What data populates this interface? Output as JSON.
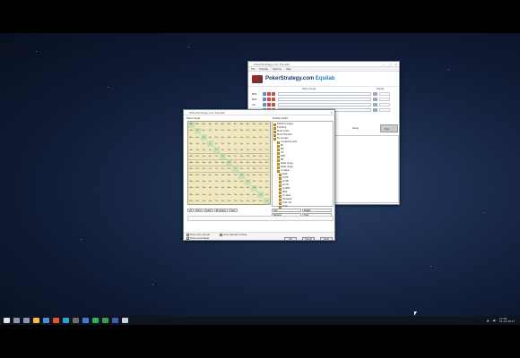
{
  "equilab": {
    "title": "PokerStrategy.com Equilab",
    "menu": [
      "File",
      "Equilab",
      "Options",
      "Help"
    ],
    "brand_main": "PokerStrategy.com",
    "brand_suffix": "Equilab",
    "col_hand": "Hand range",
    "col_equity": "Equity",
    "players": [
      {
        "label": "MP1"
      },
      {
        "label": "MP2"
      },
      {
        "label": "CO"
      },
      {
        "label": "BN"
      }
    ],
    "run_label": "Eval",
    "status_label": "Ready"
  },
  "range_dialog": {
    "title": "PokerStrategy.com Equilab",
    "left_label": "Hand range",
    "right_label": "Preflop editor",
    "grid": [
      [
        "AA",
        "AKs",
        "AQs",
        "AJs",
        "ATs",
        "A9s",
        "A8s",
        "A7s",
        "A6s",
        "A5s",
        "A4s",
        "A3s",
        "A2s"
      ],
      [
        "AKo",
        "KK",
        "KQs",
        "KJs",
        "KTs",
        "K9s",
        "K8s",
        "K7s",
        "K6s",
        "K5s",
        "K4s",
        "K3s",
        "K2s"
      ],
      [
        "AQo",
        "KQo",
        "QQ",
        "QJs",
        "QTs",
        "Q9s",
        "Q8s",
        "Q7s",
        "Q6s",
        "Q5s",
        "Q4s",
        "Q3s",
        "Q2s"
      ],
      [
        "AJo",
        "KJo",
        "QJo",
        "JJ",
        "JTs",
        "J9s",
        "J8s",
        "J7s",
        "J6s",
        "J5s",
        "J4s",
        "J3s",
        "J2s"
      ],
      [
        "ATo",
        "KTo",
        "QTo",
        "JTo",
        "TT",
        "T9s",
        "T8s",
        "T7s",
        "T6s",
        "T5s",
        "T4s",
        "T3s",
        "T2s"
      ],
      [
        "A9o",
        "K9o",
        "Q9o",
        "J9o",
        "T9o",
        "99",
        "98s",
        "97s",
        "96s",
        "95s",
        "94s",
        "93s",
        "92s"
      ],
      [
        "A8o",
        "K8o",
        "Q8o",
        "J8o",
        "T8o",
        "98o",
        "88",
        "87s",
        "86s",
        "85s",
        "84s",
        "83s",
        "82s"
      ],
      [
        "A7o",
        "K7o",
        "Q7o",
        "J7o",
        "T7o",
        "97o",
        "87o",
        "77",
        "76s",
        "75s",
        "74s",
        "73s",
        "72s"
      ],
      [
        "A6o",
        "K6o",
        "Q6o",
        "J6o",
        "T6o",
        "96o",
        "86o",
        "76o",
        "66",
        "65s",
        "64s",
        "63s",
        "62s"
      ],
      [
        "A5o",
        "K5o",
        "Q5o",
        "J5o",
        "T5o",
        "95o",
        "85o",
        "75o",
        "65o",
        "55",
        "54s",
        "53s",
        "52s"
      ],
      [
        "A4o",
        "K4o",
        "Q4o",
        "J4o",
        "T4o",
        "94o",
        "84o",
        "74o",
        "64o",
        "54o",
        "44",
        "43s",
        "42s"
      ],
      [
        "A3o",
        "K3o",
        "Q3o",
        "J3o",
        "T3o",
        "93o",
        "83o",
        "73o",
        "63o",
        "53o",
        "43o",
        "33",
        "32s"
      ],
      [
        "A2o",
        "K2o",
        "Q2o",
        "J2o",
        "T2o",
        "92o",
        "82o",
        "72o",
        "62o",
        "52o",
        "42o",
        "32o",
        "22"
      ]
    ],
    "tree": [
      "Default ranges",
      "Full Ring",
      "6max Cash",
      "Short Handed",
      "My ranges",
      "Unopened pots",
      "EP",
      "MP",
      "CO",
      "BTN",
      "SB",
      "Steal range",
      "Steal range",
      "vs Steal",
      "3bet",
      "vs EP",
      "vs MP",
      "vs CO",
      "vs BTN",
      "4bet",
      "vs 3bet",
      "Squeeze",
      "Cold call",
      "Limp"
    ],
    "controls": [
      "All",
      "Pairs",
      "Suited",
      "Broadway",
      "Clear"
    ],
    "tree_buttons": [
      "Add",
      "Delete",
      "Rename",
      "Save"
    ],
    "status": "",
    "check1": "Show card removal",
    "check2": "Show selected combos",
    "check3": "Show percentages",
    "ok_label": "OK",
    "cancel_label": "Cancel",
    "apply_label": "Apply"
  },
  "tray": {
    "time": "12:00",
    "date": "01.01.2017"
  },
  "colors": {
    "accent": "#123a6e",
    "grid_pair": "#c6e1b6",
    "grid_suited": "#f1e7be"
  }
}
